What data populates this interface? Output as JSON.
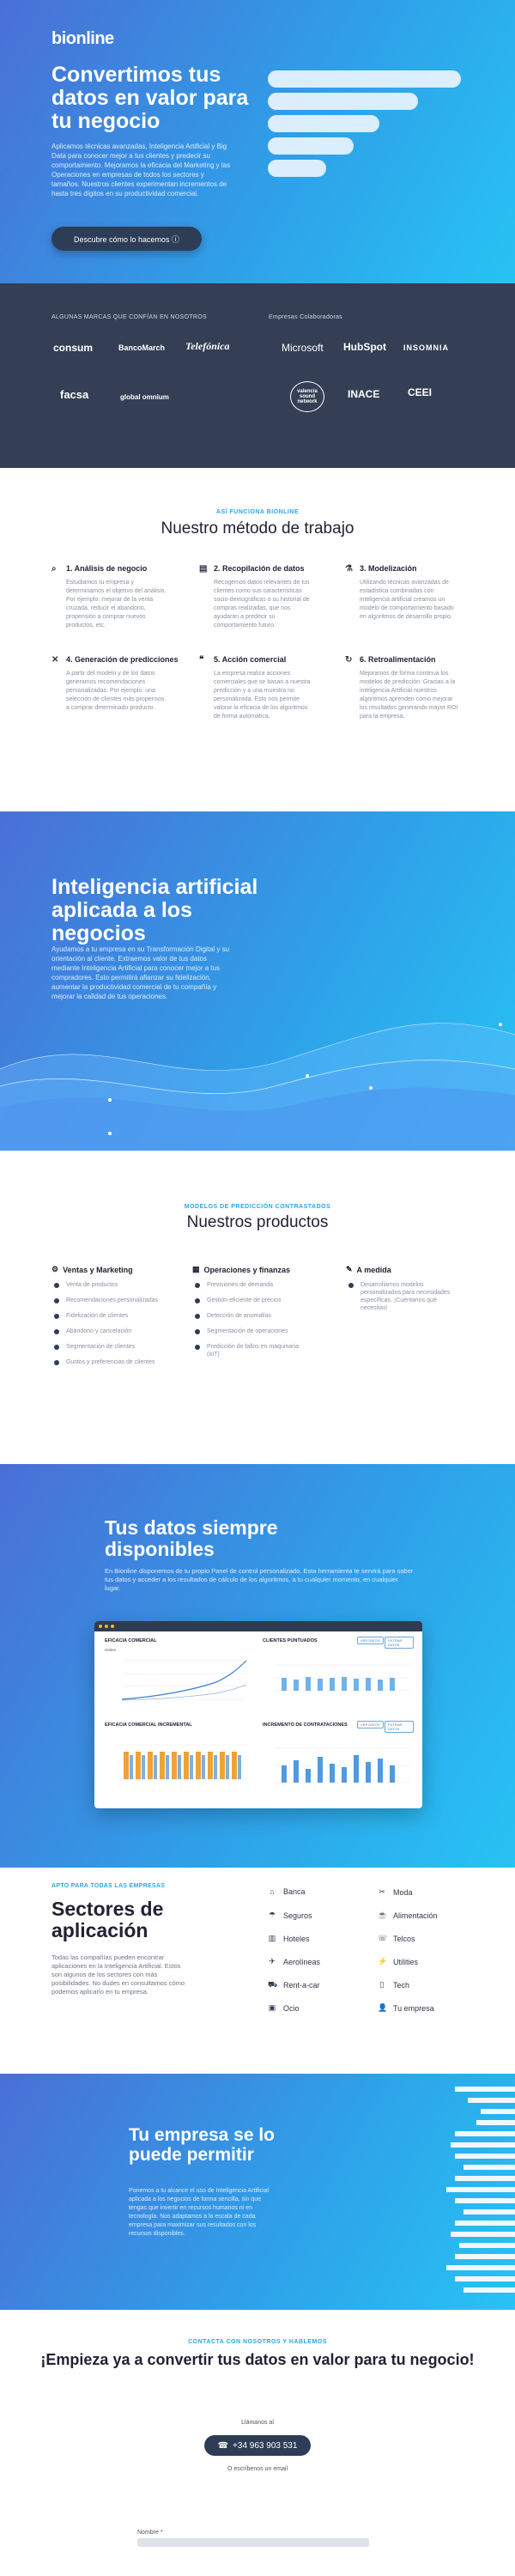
{
  "hero": {
    "logo": "bionline",
    "title": "Convertimos tus datos en valor para tu negocio",
    "description": "Aplicamos técnicas avanzadas, Inteligencia Artificial y Big Data para conocer mejor a tus clientes y predecir su comportamiento. Mejoramos la eficacia del Marketing y las Operaciones en empresas de todos los sectores y tamaños. Nuestros clientes experimentan incrementos de hasta tres dígitos en su productividad comercial.",
    "cta": "Descubre cómo lo hacemos ⓘ"
  },
  "brands": {
    "left_heading": "ALGUNAS MARCAS QUE CONFÍAN EN NOSOTROS",
    "right_heading": "Empresas Colaboradoras",
    "clients": [
      "consum",
      "BancoMarch",
      "Telefónica",
      "facsa",
      "global omnium"
    ],
    "partners": [
      "Microsoft",
      "HubSpot",
      "INSOMNIA",
      "valencia sound network",
      "INACE",
      "CEEI"
    ]
  },
  "method": {
    "kicker": "ASÍ FUNCIONA BIONLINE",
    "title": "Nuestro método de trabajo",
    "steps": [
      {
        "icon": "⌕",
        "title": "1. Análisis de negocio",
        "text": "Estudiamos tu empresa y determinamos el objetivo del análisis. Por ejemplo: mejorar de la venta cruzada, reducir el abandono, propensión a comprar nuevos productos, etc."
      },
      {
        "icon": "▤",
        "title": "2. Recopilación de datos",
        "text": "Recogemos datos relevantes de tus clientes como sus características socio-demográficas o su historial de compras realizadas, que nos ayudarán a predecir su comportamiento futuro."
      },
      {
        "icon": "⚗",
        "title": "3. Modelización",
        "text": "Utilizando técnicas avanzadas de estadística combinadas con inteligencia artificial creamos un modelo de comportamiento basado en algoritmos de desarrollo propio."
      },
      {
        "icon": "✕",
        "title": "4. Generación de predicciones",
        "text": "A partir del modelo y de los datos generamos recomendaciones personalizadas. Por ejemplo: una selección de clientes más propensos a comprar determinado producto."
      },
      {
        "icon": "❝",
        "title": "5. Acción comercial",
        "text": "La empresa realiza acciones comerciales que se basan a nuestra predicción y a una muestra no personalizada. Esto nos permite valorar la eficacia de los algoritmos de forma automática."
      },
      {
        "icon": "↻",
        "title": "6. Retroalimentación",
        "text": "Mejoramos de forma continua los modelos de predicción. Gracias a la inteligencia Artificial nuestros algoritmos aprenden cómo mejorar los resultados generando mayor ROI para la empresa."
      }
    ]
  },
  "ai": {
    "title": "Inteligencia artificial aplicada a los negocios",
    "description": "Ayudamos a tu empresa en su Transformación Digital y su orientación al cliente. Extraemos valor de tus datos mediante Inteligencia Artificial para conocer mejor a tus compradores. Esto permitirá afianzar su fidelización, aumentar la productividad comercial de tu compañía y mejorar la calidad de tus operaciones."
  },
  "products": {
    "kicker": "MODELOS DE PREDICCIÓN CONTRASTADOS",
    "title": "Nuestros productos",
    "columns": [
      {
        "icon": "⚙",
        "title": "Ventas y Marketing",
        "items": [
          "Venta de productos",
          "Recomendaciones personalizadas",
          "Fidelización de clientes",
          "Abandono y cancelación",
          "Segmentación de clientes",
          "Gustos y preferencias de clientes"
        ]
      },
      {
        "icon": "▦",
        "title": "Operaciones y finanzas",
        "items": [
          "Previsiones de demanda",
          "Gestión eficiente de precios",
          "Detección de anomalías",
          "Segmentación de operaciones",
          "Predicción de fallos en maquinaria (IoT)"
        ]
      },
      {
        "icon": "✎",
        "title": "A medida",
        "items": [
          "Desarrollamos modelos personalizados para necesidades específicas. ¡Cuéntanos qué necesitas!"
        ]
      }
    ]
  },
  "data": {
    "title": "Tus datos siempre disponibles",
    "description": "En Bionline disponemos de tu propio Panel de control personalizado. Esta herramienta te servirá para saber tus datos y acceder a los resultados de cálculo de los algoritmos, a tu cualquier momento, en cualquier lugar.",
    "panels": {
      "p1_title": "EFICACIA COMERCIAL",
      "p1_filter": "Online",
      "p2_title": "CLIENTES PUNTUADOS",
      "p3_title": "EFICACIA COMERCIAL INCREMENTAL",
      "p4_title": "INCREMENTO DE CONTRATACIONES",
      "btn_a": "VER DATOS",
      "btn_b": "FILTRAR DATOS"
    }
  },
  "sectors": {
    "kicker": "APTO PARA TODAS LAS EMPRESAS",
    "title": "Sectores de aplicación",
    "description": "Todas las compañías pueden encontrar aplicaciones en la Inteligencia Artificial. Estos son algunos de los sectores con más posibilidades. No dudes en consultarnos cómo podemos aplicarlo en tu empresa.",
    "items": [
      {
        "icon": "⌂",
        "label": "Banca"
      },
      {
        "icon": "✂",
        "label": "Moda"
      },
      {
        "icon": "☂",
        "label": "Seguros"
      },
      {
        "icon": "☕",
        "label": "Alimentación"
      },
      {
        "icon": "▥",
        "label": "Hoteles"
      },
      {
        "icon": "☏",
        "label": "Telcos"
      },
      {
        "icon": "✈",
        "label": "Aerolíneas"
      },
      {
        "icon": "⚡",
        "label": "Utilities"
      },
      {
        "icon": "⛟",
        "label": "Rent-a-car"
      },
      {
        "icon": "▯",
        "label": "Tech"
      },
      {
        "icon": "▣",
        "label": "Ocio"
      },
      {
        "icon": "👤",
        "label": "Tu empresa"
      }
    ]
  },
  "company": {
    "title": "Tu empresa se lo puede permitir",
    "description": "Ponemos a tu alcance el uso de Inteligencia Artificial aplicada a los negocios de forma sencilla, sin que tengas que invertir en recursos humanos ni en tecnología. Nos adaptamos a la escala de cada empresa para maximizar sus resultados con los recursos disponibles."
  },
  "contact": {
    "kicker": "CONTACTA CON NOSOTROS Y HABLEMOS",
    "title": "¡Empieza ya a convertir tus datos en valor para tu negocio!",
    "call_label": "Llámanos al",
    "phone": "+34 963 903 531",
    "email_label": "O escríbenos un email",
    "name_label": "Nombre *"
  },
  "colors": {
    "accent": "#2aa6e6",
    "dark": "#2d3d55",
    "brands_bg": "#343f55"
  }
}
